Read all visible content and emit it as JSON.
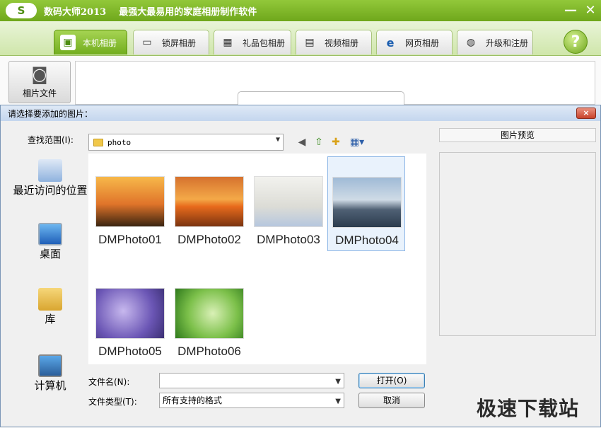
{
  "app": {
    "logo": "S",
    "title": "数码大师2013",
    "slogan": "最强大最易用的家庭相册制作软件",
    "minimize_glyph": "—",
    "close_glyph": "✕"
  },
  "tabs": [
    {
      "label": "本机相册",
      "icon": "photo-album-icon",
      "active": true
    },
    {
      "label": "锁屏相册",
      "icon": "monitor-icon"
    },
    {
      "label": "礼品包相册",
      "icon": "gift-icon"
    },
    {
      "label": "视频相册",
      "icon": "film-icon"
    },
    {
      "label": "网页相册",
      "icon": "ie-icon"
    },
    {
      "label": "升级和注册",
      "icon": "globe-icon"
    }
  ],
  "help_glyph": "?",
  "left_tool": {
    "label": "相片文件",
    "icon": "camera-icon"
  },
  "dialog": {
    "title": "请选择要添加的图片：",
    "close_glyph": "×",
    "look_in_label": "查找范围(I):",
    "look_in_value": "photo",
    "places": [
      "最近访问的位置",
      "桌面",
      "库",
      "计算机"
    ],
    "files": [
      "DMPhoto01",
      "DMPhoto02",
      "DMPhoto03",
      "DMPhoto04",
      "DMPhoto05",
      "DMPhoto06"
    ],
    "selected_file": "DMPhoto04",
    "filename_label": "文件名(N):",
    "filename_value": "",
    "filetype_label": "文件类型(T):",
    "filetype_value": "所有支持的格式",
    "open_button": "打开(O)",
    "cancel_button": "取消",
    "preview_label": "图片预览"
  },
  "watermark": "极速下载站",
  "colors": {
    "brand_green": "#7ab32a",
    "dialog_title": "#c4d6ee",
    "selection": "#e9f2fc"
  }
}
